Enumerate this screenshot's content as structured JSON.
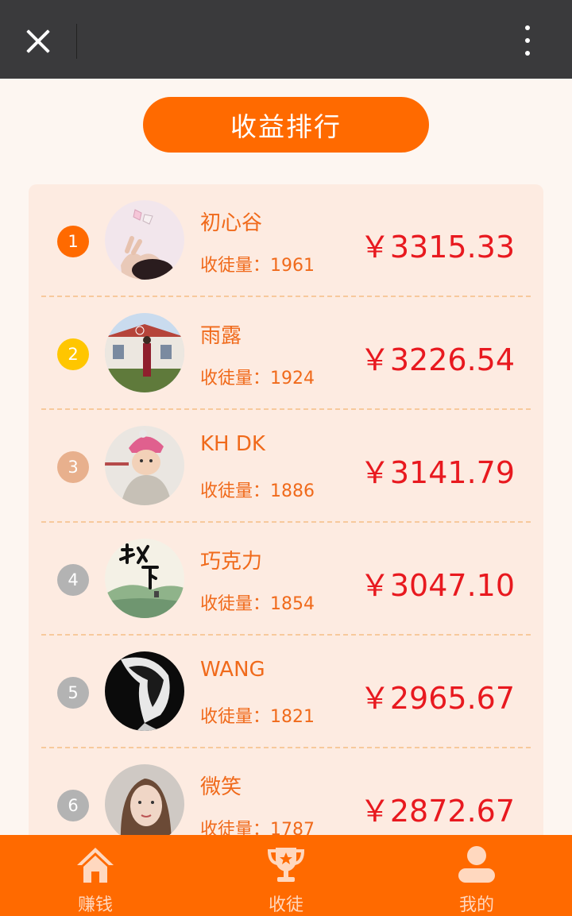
{
  "header": {
    "close_icon": "close-icon",
    "more_icon": "more-vertical-icon"
  },
  "title": "收益排行",
  "colors": {
    "accent": "#ff6a00",
    "amount": "#e8191f",
    "rank_1": "#ff6a00",
    "rank_2": "#ffc600",
    "rank_3": "#e8b08d",
    "rank_other": "#b3b3b3"
  },
  "ranking": [
    {
      "rank": "1",
      "name": "初心谷",
      "count": "收徒量：1961",
      "amount": "￥3315.33"
    },
    {
      "rank": "2",
      "name": "雨露",
      "count": "收徒量：1924",
      "amount": "￥3226.54"
    },
    {
      "rank": "3",
      "name": "KH DK",
      "count": "收徒量：1886",
      "amount": "￥3141.79"
    },
    {
      "rank": "4",
      "name": "巧克力",
      "count": "收徒量：1854",
      "amount": "￥3047.10"
    },
    {
      "rank": "5",
      "name": "WANG",
      "count": "收徒量：1821",
      "amount": "￥2965.67"
    },
    {
      "rank": "6",
      "name": "微笑",
      "count": "收徒量：1787",
      "amount": "￥2872.67"
    }
  ],
  "tabs": [
    {
      "label": "赚钱",
      "icon": "home-icon"
    },
    {
      "label": "收徒",
      "icon": "trophy-icon"
    },
    {
      "label": "我的",
      "icon": "user-icon"
    }
  ]
}
